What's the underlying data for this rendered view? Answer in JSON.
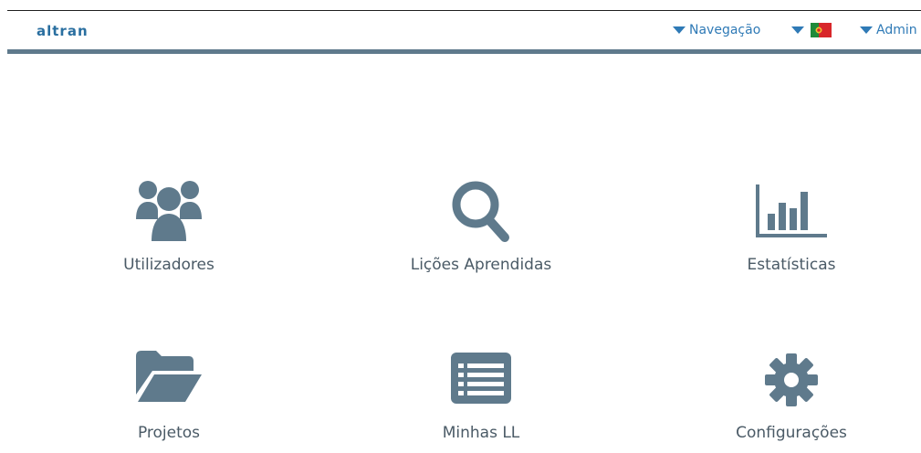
{
  "header": {
    "logo": "altran",
    "navigation_label": "Navegação",
    "user_label": "Admin",
    "accent_color": "#2f7ab6",
    "bar_color": "#5f7a8c"
  },
  "tiles": [
    {
      "label": "Utilizadores",
      "icon": "users-icon"
    },
    {
      "label": "Lições Aprendidas",
      "icon": "search-icon"
    },
    {
      "label": "Estatísticas",
      "icon": "bar-chart-icon"
    },
    {
      "label": "Projetos",
      "icon": "folder-open-icon"
    },
    {
      "label": "Minhas LL",
      "icon": "list-icon"
    },
    {
      "label": "Configurações",
      "icon": "gear-icon"
    }
  ],
  "colors": {
    "icon": "#5f7a8c",
    "label": "#4a5a66"
  }
}
